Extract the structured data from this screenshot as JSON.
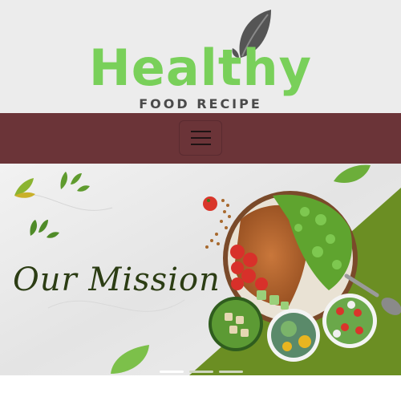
{
  "brand": {
    "name": "Healthy",
    "tagline": "FOOD RECIPE",
    "name_color": "#79d05a",
    "tagline_color": "#4a4a4a",
    "leaf_color": "#555555"
  },
  "nav": {
    "background": "#6b3438",
    "menu_icon": "hamburger-icon"
  },
  "hero": {
    "heading": "Our Mission",
    "heading_color": "#2c3d14",
    "accent_green": "#6b8e23",
    "slides_total": 3,
    "active_slide": 1
  }
}
